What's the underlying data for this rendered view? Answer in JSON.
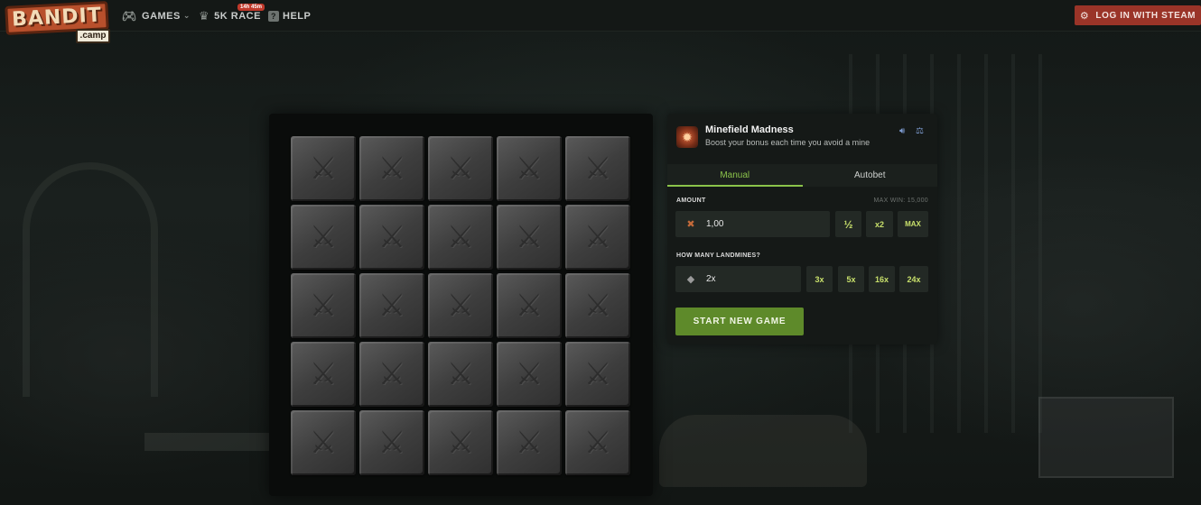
{
  "header": {
    "logo_text": "BANDIT",
    "logo_sub": ".camp",
    "nav": {
      "games_label": "GAMES",
      "race_label": "5K RACE",
      "race_badge": "14h 45m",
      "help_label": "HELP"
    },
    "login_label": "LOG IN WITH STEAM"
  },
  "board": {
    "rows": 5,
    "cols": 5,
    "tile_icon": "crossed-swords-icon"
  },
  "panel": {
    "game_title": "Minefield Madness",
    "game_subtitle": "Boost your bonus each time you avoid a mine",
    "tabs": [
      {
        "label": "Manual",
        "active": true
      },
      {
        "label": "Autobet",
        "active": false
      }
    ],
    "amount_label": "AMOUNT",
    "max_win": "MAX WIN: 15,000",
    "amount_value": "1,00",
    "amount_buttons": [
      "½",
      "x2",
      "MAX"
    ],
    "landmines_label": "HOW MANY LANDMINES?",
    "landmines_value": "2x",
    "landmine_buttons": [
      "3x",
      "5x",
      "16x",
      "24x"
    ],
    "start_label": "START NEW GAME"
  },
  "colors": {
    "accent_green": "#8bc34a",
    "start_button": "#5e8a2a",
    "login_button": "#9a3428"
  }
}
